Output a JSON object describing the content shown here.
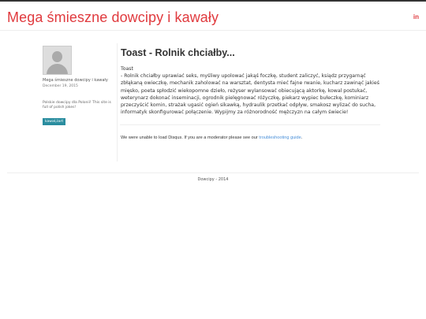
{
  "header": {
    "site_title": "Mega śmieszne dowcipy i kawały",
    "social_label": "in"
  },
  "author": {
    "name": "Mega śmieszne dowcipy i kawały",
    "date": "December 19, 2015",
    "description": "Polskie dowcipy dla Polonii! This site is full of polish jokes!",
    "tag": "kawał,żart"
  },
  "post": {
    "title": "Toast - Rolnik chciałby...",
    "intro": "Toast",
    "body": "- Rolnik chciałby uprawiać seks, myśliwy upolować jakąś foczkę, student zaliczyć, ksiądz przygarnąć zbłąkaną owieczkę, mechanik zaholować na warsztat, dentysta mieć fajne rwanie, kucharz zawinąć jakieś mięsko, poeta spłodzić wiekopomne dzieło, reżyser wylansować obiecującą aktorkę, kowal postukać, weterynarz dokonać inseminacji, ogrodnik pielęgnować różyczkę, piekarz wypiec bułeczkę, kominiarz przeczyścić komin, strażak ugasić ogień sikawką, hydraulik przetkać odpływ, smakosz wylizać do sucha, informatyk skonfigurować połączenie. Wypijmy za różnorodność mężczyzn na całym świecie!"
  },
  "disqus": {
    "message": "We were unable to load Disqus. If you are a moderator please see our",
    "link_text": "troubleshooting guide",
    "end": "."
  },
  "footer": {
    "text": "Dowcipy - 2014"
  },
  "colors": {
    "accent": "#e03a3e",
    "tag": "#2a8d9f",
    "link": "#4a90d9"
  }
}
